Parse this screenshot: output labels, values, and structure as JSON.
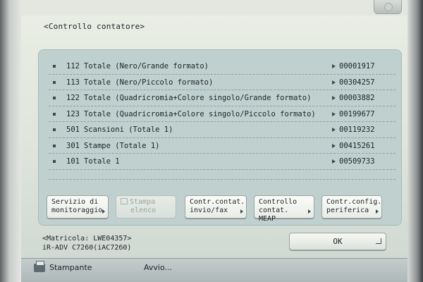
{
  "screen": {
    "title": "<Controllo contatore>"
  },
  "counters": [
    {
      "code": "112",
      "label": "Totale (Nero/Grande formato)",
      "value": "00001917"
    },
    {
      "code": "113",
      "label": "Totale (Nero/Piccolo formato)",
      "value": "00304257"
    },
    {
      "code": "122",
      "label": "Totale (Quadricromia+Colore singolo/Grande formato)",
      "value": "00003882"
    },
    {
      "code": "123",
      "label": "Totale (Quadricromia+Colore singolo/Piccolo formato)",
      "value": "00199677"
    },
    {
      "code": "501",
      "label": "Scansioni (Totale 1)",
      "value": "00119232"
    },
    {
      "code": "301",
      "label": "Stampe (Totale 1)",
      "value": "00415261"
    },
    {
      "code": "101",
      "label": "Totale 1",
      "value": "00509733"
    }
  ],
  "buttons": {
    "monitoring": {
      "line1": "Servizio di",
      "line2": "monitoraggio"
    },
    "print_list": {
      "line1": "Stampa",
      "line2": "elenco"
    },
    "send_fax": {
      "line1": "Contr.contat.",
      "line2": "invio/fax"
    },
    "meap": {
      "line1": "Controllo",
      "line2": "contat. MEAP"
    },
    "device_config": {
      "line1": "Contr.config.",
      "line2": "periferica"
    },
    "ok": "OK"
  },
  "device": {
    "serial": "<Matricola: LWE04357>",
    "model": "iR-ADV C7260(iAC7260)"
  },
  "taskbar": {
    "app": "Stampante",
    "status": "Avvio..."
  }
}
